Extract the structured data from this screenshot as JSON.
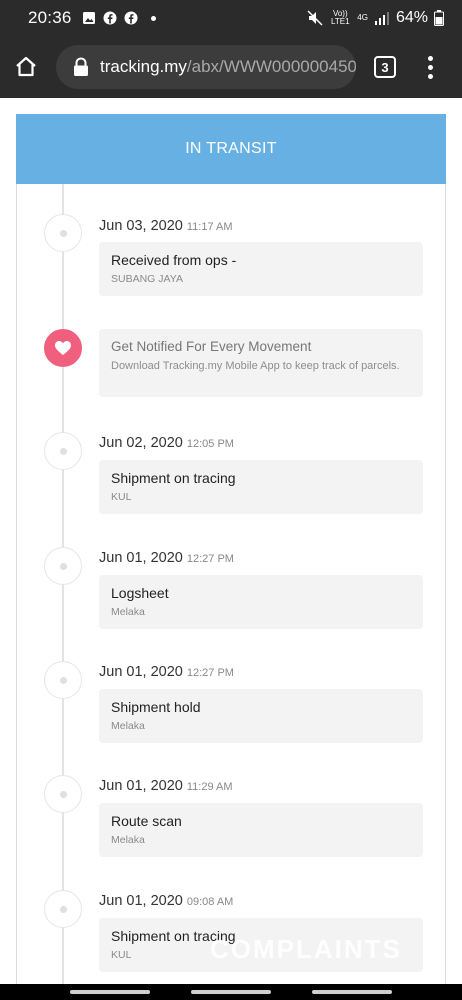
{
  "status_bar": {
    "time": "20:36",
    "network": "4G",
    "volte": "Vo)) LTE1",
    "battery": "64%"
  },
  "browser": {
    "url_host": "tracking.my",
    "url_path": "/abx/WWW000000450",
    "tab_count": "3"
  },
  "tracking": {
    "status": "IN TRANSIT",
    "events": [
      {
        "date": "Jun 03, 2020",
        "time": "11:17 AM",
        "title": "Received from ops -",
        "location": "SUBANG JAYA"
      },
      {
        "date": "Jun 02, 2020",
        "time": "12:05 PM",
        "title": "Shipment on tracing",
        "location": "KUL"
      },
      {
        "date": "Jun 01, 2020",
        "time": "12:27 PM",
        "title": "Logsheet",
        "location": "Melaka"
      },
      {
        "date": "Jun 01, 2020",
        "time": "12:27 PM",
        "title": "Shipment hold",
        "location": "Melaka"
      },
      {
        "date": "Jun 01, 2020",
        "time": "11:29 AM",
        "title": "Route scan",
        "location": "Melaka"
      },
      {
        "date": "Jun 01, 2020",
        "time": "09:08 AM",
        "title": "Shipment on tracing",
        "location": "KUL"
      }
    ],
    "promo": {
      "title": "Get Notified For Every Movement",
      "text": "Download Tracking.my Mobile App to keep track of parcels."
    }
  },
  "watermark": "COMPLAINTS"
}
